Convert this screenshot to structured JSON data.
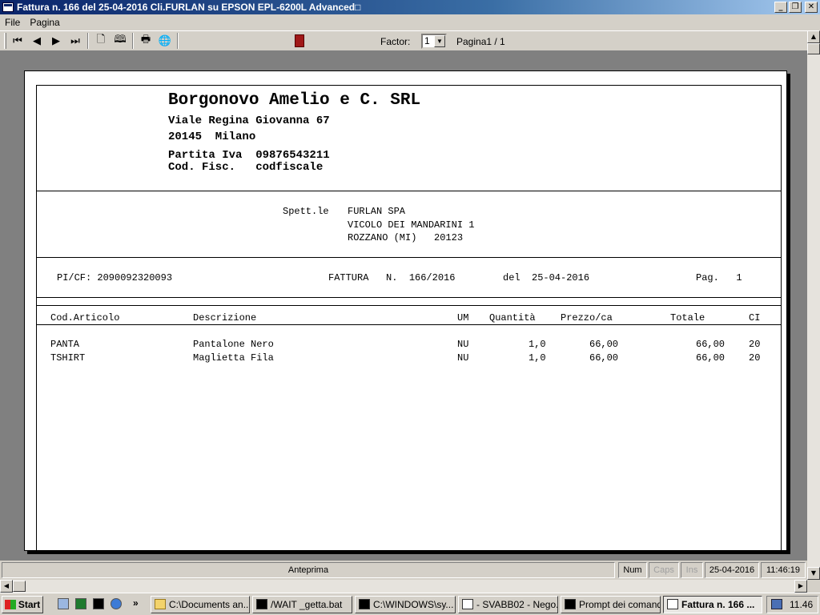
{
  "window": {
    "title": "Fattura n. 166 del 25-04-2016 Cli.FURLAN su EPSON EPL-6200L Advanced□"
  },
  "menu": [
    "File",
    "Pagina"
  ],
  "toolbar": {
    "factor_label": "Factor:",
    "factor_value": "1",
    "page_label": "Pagina1 / 1"
  },
  "invoice": {
    "company": "Borgonovo Amelio e C. SRL",
    "address": "Viale Regina Giovanna 67",
    "city": "20145  Milano",
    "piva": "Partita Iva  09876543211",
    "codfisc": "Cod. Fisc.   codfiscale",
    "spett": "Spett.le",
    "client_name": "FURLAN SPA",
    "client_address": "VICOLO DEI MANDARINI 1",
    "client_city": "ROZZANO (MI)   20123",
    "picf": "PI/CF: 2090092320093",
    "fattura": "FATTURA   N.  166/2016",
    "del": "del  25-04-2016",
    "pag": "Pag.   1",
    "columns": [
      "Cod.Articolo",
      "Descrizione",
      "UM",
      "Quantità",
      "Prezzo/ca",
      "Totale",
      "CI"
    ],
    "rows": [
      [
        "PANTA",
        "Pantalone Nero",
        "NU",
        "1,0",
        "66,00",
        "66,00",
        "20"
      ],
      [
        "TSHIRT",
        "Maglietta Fila",
        "NU",
        "1,0",
        "66,00",
        "66,00",
        "20"
      ]
    ]
  },
  "status": {
    "mode": "Anteprima",
    "num": "Num",
    "caps": "Caps",
    "ins": "Ins",
    "date": "25-04-2016",
    "time": "11:46:19"
  },
  "taskbar": {
    "start": "Start",
    "tasks": [
      "C:\\Documents an...",
      "/WAIT _getta.bat",
      "C:\\WINDOWS\\sy...",
      "- SVABB02 - Nego...",
      "Prompt dei comandi",
      "Fattura n. 166 ..."
    ],
    "clock": "11.46"
  }
}
